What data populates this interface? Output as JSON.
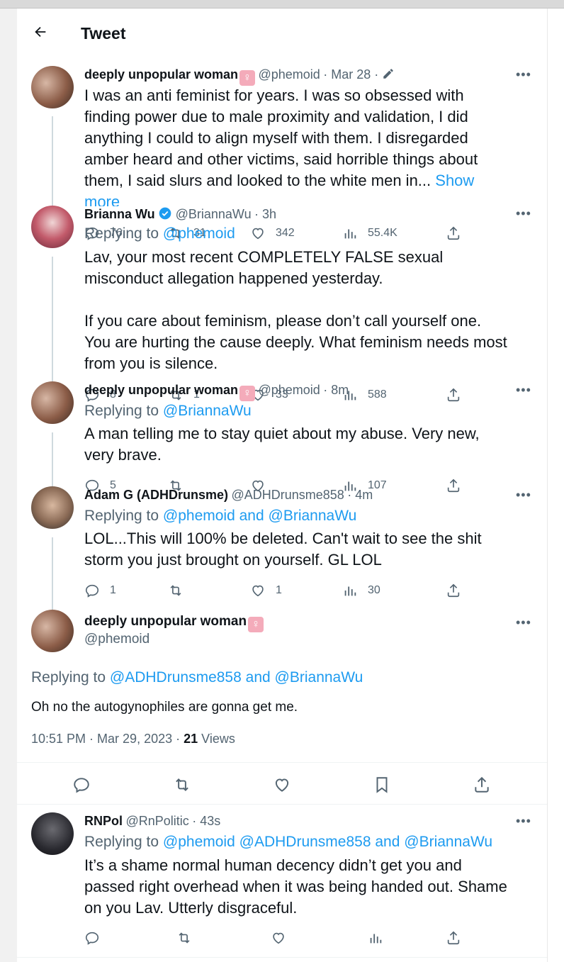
{
  "header": {
    "title": "Tweet"
  },
  "tweets": [
    {
      "name": "deeply unpopular woman",
      "handle": "@phemoid",
      "time": "· Mar 28 ·",
      "body_lines": [
        "I was an anti feminist for years. I was so obsessed with",
        "finding power due to male proximity and validation, I did",
        "anything I could to align myself with them. I disregarded",
        "amber heard and other victims, said horrible things about",
        "them, I said slurs and looked to the white men in... "
      ],
      "show_more_1": "Show",
      "show_more_2": "more",
      "replies": "76",
      "retweets": "31",
      "likes": "342",
      "views": "55.4K"
    },
    {
      "name": "Brianna Wu",
      "handle": "@BriannaWu",
      "time": "· 3h",
      "replying_label": "Replying to",
      "replying_to": "@phemoid",
      "body_lines": [
        "Lav, your most recent COMPLETELY FALSE sexual",
        "misconduct allegation happened yesterday.",
        "",
        "If you care about feminism, please don’t call yourself one.",
        "You are hurting the cause deeply. What feminism needs most",
        "from you is silence."
      ],
      "replies": "8",
      "retweets": "1",
      "likes": "33",
      "views": "588"
    },
    {
      "name": "deeply unpopular woman",
      "handle": "@phemoid",
      "time": "· 8m",
      "replying_label": "Replying to",
      "replying_to": "@BriannaWu",
      "body_lines": [
        "A man telling me to stay quiet  about my abuse. Very new,",
        "very brave."
      ],
      "replies": "5",
      "retweets": "",
      "likes": "",
      "views": "107"
    },
    {
      "name": "Adam G (ADHDrunsme)",
      "handle": "@ADHDrunsme858",
      "time": "· 4m",
      "replying_label": "Replying to",
      "replying_to": "@phemoid",
      "replying_and": "and",
      "replying_to_2": "@BriannaWu",
      "body_lines": [
        "LOL...This will 100% be deleted. Can't wait to see the shit",
        "storm you just brought on yourself. GL LOL"
      ],
      "replies": "1",
      "retweets": "",
      "likes": "1",
      "views": "30"
    }
  ],
  "main": {
    "name": "deeply unpopular woman",
    "handle": "@phemoid",
    "replying_label": "Replying to",
    "replying_to": "@ADHDrunsme858",
    "replying_and": "and",
    "replying_to_2": "@BriannaWu",
    "body": "Oh no the autogynophiles are gonna get me.",
    "timestamp": "10:51 PM · Mar 29, 2023 · ",
    "views_count": "21",
    "views_label": " Views"
  },
  "reply": {
    "name": "RNPol",
    "handle": "@RnPolitic",
    "time": "· 43s",
    "replying_label": "Replying to",
    "replying_to": "@phemoid",
    "replying_to_2": "@ADHDrunsme858",
    "replying_and": "and",
    "replying_to_3": "@BriannaWu",
    "body_lines": [
      "It’s a shame normal human decency didn’t get you and",
      "passed right overhead when it was being handed out. Shame",
      "on you Lav. Utterly disgraceful."
    ]
  },
  "colors": {
    "link": "#1d9bf0",
    "muted": "#536471",
    "text": "#0f1419"
  },
  "icons": [
    "back-arrow-icon",
    "verified-badge-icon",
    "female-sign-icon",
    "edit-pencil-icon",
    "more-dots-icon",
    "reply-icon",
    "retweet-icon",
    "like-icon",
    "views-icon",
    "share-icon",
    "bookmark-icon"
  ]
}
